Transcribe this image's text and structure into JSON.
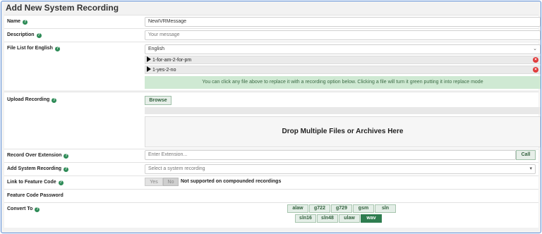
{
  "page_title": "Add New System Recording",
  "name": {
    "label": "Name",
    "value": "NewIVRMessage"
  },
  "description": {
    "label": "Description",
    "placeholder": "Your message"
  },
  "file_list": {
    "label": "File List for English",
    "language": "English",
    "files": [
      "1-for-am-2-for-pm",
      "1-yes-2-no"
    ],
    "notice": "You can click any file above to replace it with a recording option below. Clicking a file will turn it green putting it into replace mode"
  },
  "upload": {
    "label": "Upload Recording",
    "browse_label": "Browse",
    "dropzone_text": "Drop Multiple Files or Archives Here"
  },
  "record_over_extension": {
    "label": "Record Over Extension",
    "placeholder": "Enter Extension...",
    "call_label": "Call"
  },
  "add_system_recording": {
    "label": "Add System Recording",
    "placeholder": "Select a system recording"
  },
  "feature_code": {
    "label": "Link to Feature Code",
    "yes_label": "Yes",
    "no_label": "No",
    "note": "Not supported on compounded recordings"
  },
  "feature_code_password": {
    "label": "Feature Code Password"
  },
  "convert_to": {
    "label": "Convert To",
    "row1": [
      "alaw",
      "g722",
      "g729",
      "gsm",
      "sln"
    ],
    "row2": [
      "sln16",
      "sln48",
      "ulaw",
      "wav"
    ],
    "active": "wav"
  },
  "colors": {
    "accent_green": "#2e7d4f",
    "notice_bg": "#cfe9d3",
    "remove_red": "#e03b3b",
    "frame_border": "#5b8dd6"
  }
}
